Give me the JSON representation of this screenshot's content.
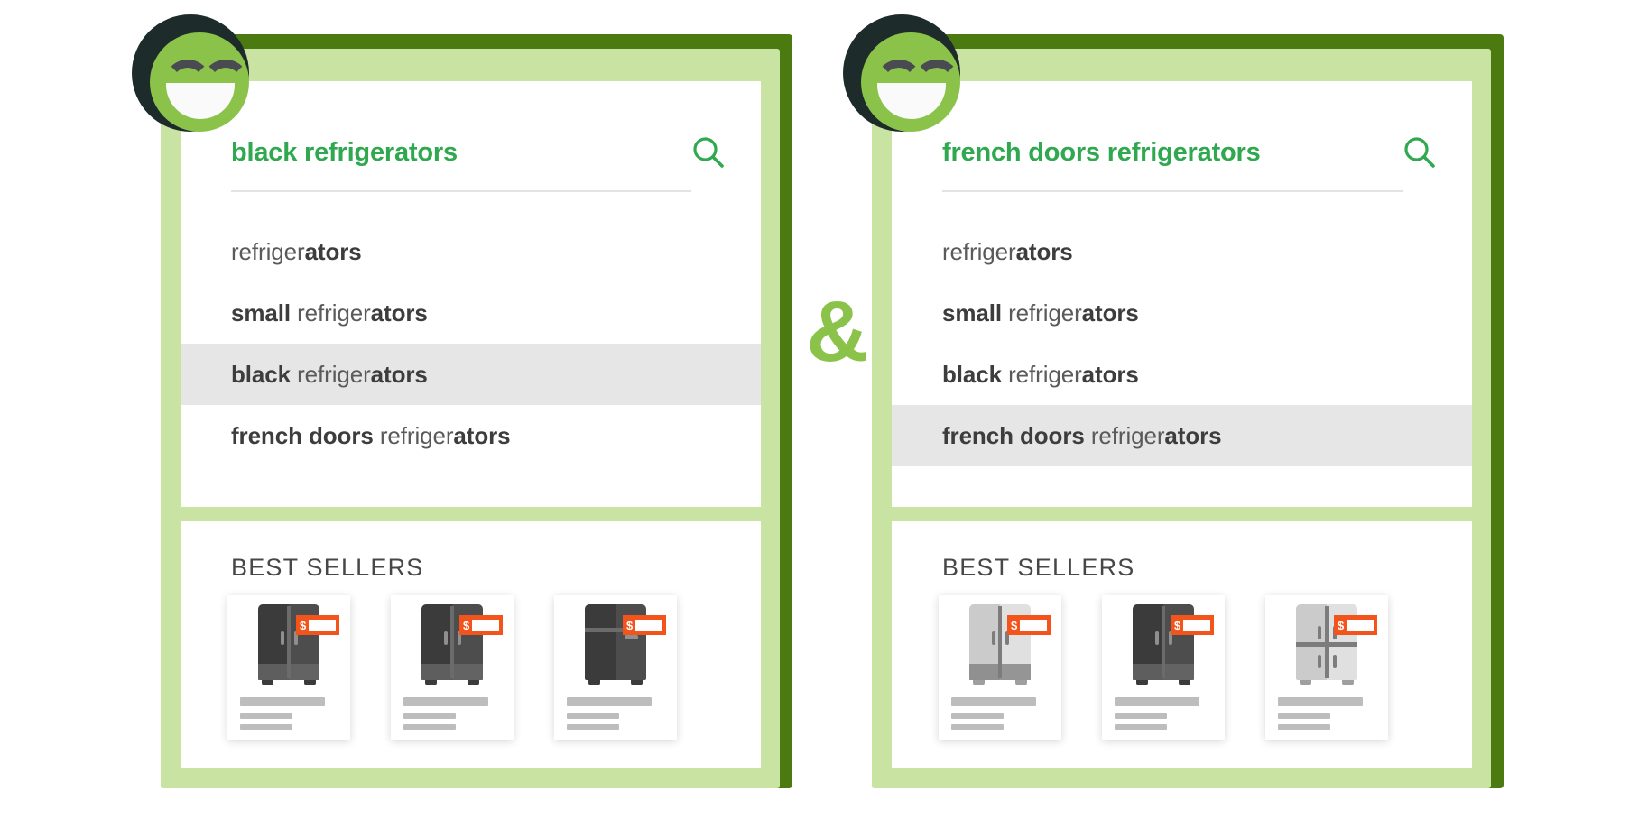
{
  "theme": {
    "frame_outer": "#4a7a10",
    "frame_inner": "#c9e3a2",
    "accent_green": "#8bc34a",
    "search_text_green": "#2fa84f",
    "price_orange": "#f2541b",
    "highlight_gray": "#e6e6e6",
    "fridge_dark": "#3d3d3d",
    "fridge_light": "#cfcfcf"
  },
  "separator": {
    "symbol": "&",
    "name": "ampersand-separator"
  },
  "panels": [
    {
      "id": "left",
      "avatar": "smiley-face-icon",
      "search": {
        "query": "black refrigerators",
        "icon": "search-icon"
      },
      "suggestions": [
        {
          "bold_prefix": "",
          "regular": "refriger",
          "bold_suffix": "ators",
          "selected": false
        },
        {
          "bold_prefix": "small ",
          "regular": "refriger",
          "bold_suffix": "ators",
          "selected": false
        },
        {
          "bold_prefix": "black ",
          "regular": "refriger",
          "bold_suffix": "ators",
          "selected": true
        },
        {
          "bold_prefix": "french doors ",
          "regular": "refriger",
          "bold_suffix": "ators",
          "selected": false
        }
      ],
      "best_sellers": {
        "title": "BEST SELLERS",
        "products": [
          {
            "name": "product-card",
            "style": "side-by-side",
            "color": "dark",
            "price_symbol": "$"
          },
          {
            "name": "product-card",
            "style": "side-by-side",
            "color": "dark",
            "price_symbol": "$"
          },
          {
            "name": "product-card",
            "style": "top-freezer",
            "color": "dark",
            "price_symbol": "$"
          }
        ]
      }
    },
    {
      "id": "right",
      "avatar": "smiley-face-icon",
      "search": {
        "query": "french doors refrigerators",
        "icon": "search-icon"
      },
      "suggestions": [
        {
          "bold_prefix": "",
          "regular": "refriger",
          "bold_suffix": "ators",
          "selected": false
        },
        {
          "bold_prefix": "small ",
          "regular": "refriger",
          "bold_suffix": "ators",
          "selected": false
        },
        {
          "bold_prefix": "black ",
          "regular": "refriger",
          "bold_suffix": "ators",
          "selected": false
        },
        {
          "bold_prefix": "french doors ",
          "regular": "refriger",
          "bold_suffix": "ators",
          "selected": true
        }
      ],
      "best_sellers": {
        "title": "BEST SELLERS",
        "products": [
          {
            "name": "product-card",
            "style": "side-by-side",
            "color": "light",
            "price_symbol": "$"
          },
          {
            "name": "product-card",
            "style": "side-by-side",
            "color": "dark",
            "price_symbol": "$"
          },
          {
            "name": "product-card",
            "style": "french-4-door",
            "color": "light",
            "price_symbol": "$"
          }
        ]
      }
    }
  ]
}
